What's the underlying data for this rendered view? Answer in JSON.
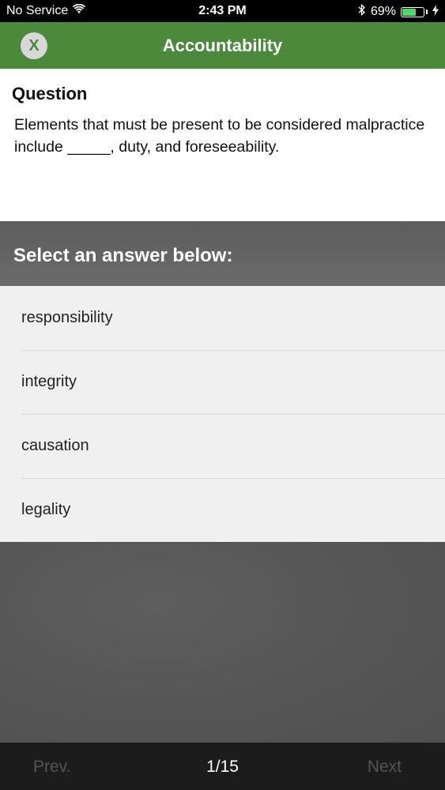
{
  "status_bar": {
    "carrier": "No Service",
    "wifi_icon": "wifi-icon",
    "time": "2:43 PM",
    "bluetooth_icon": "bluetooth-icon",
    "battery_percent": "69%",
    "battery_level": 0.69,
    "battery_color": "#4cd964",
    "charging_icon": "bolt-icon"
  },
  "nav": {
    "close_label": "X",
    "title": "Accountability",
    "bar_color": "#4b8a3a"
  },
  "question": {
    "heading": "Question",
    "text": "Elements that must be present to be considered malpractice include _____, duty, and foreseeability."
  },
  "answers": {
    "header": "Select an answer below:",
    "options": [
      {
        "label": "responsibility"
      },
      {
        "label": "integrity"
      },
      {
        "label": "causation"
      },
      {
        "label": "legality"
      }
    ]
  },
  "footer": {
    "prev_label": "Prev.",
    "page_indicator": "1/15",
    "next_label": "Next"
  }
}
